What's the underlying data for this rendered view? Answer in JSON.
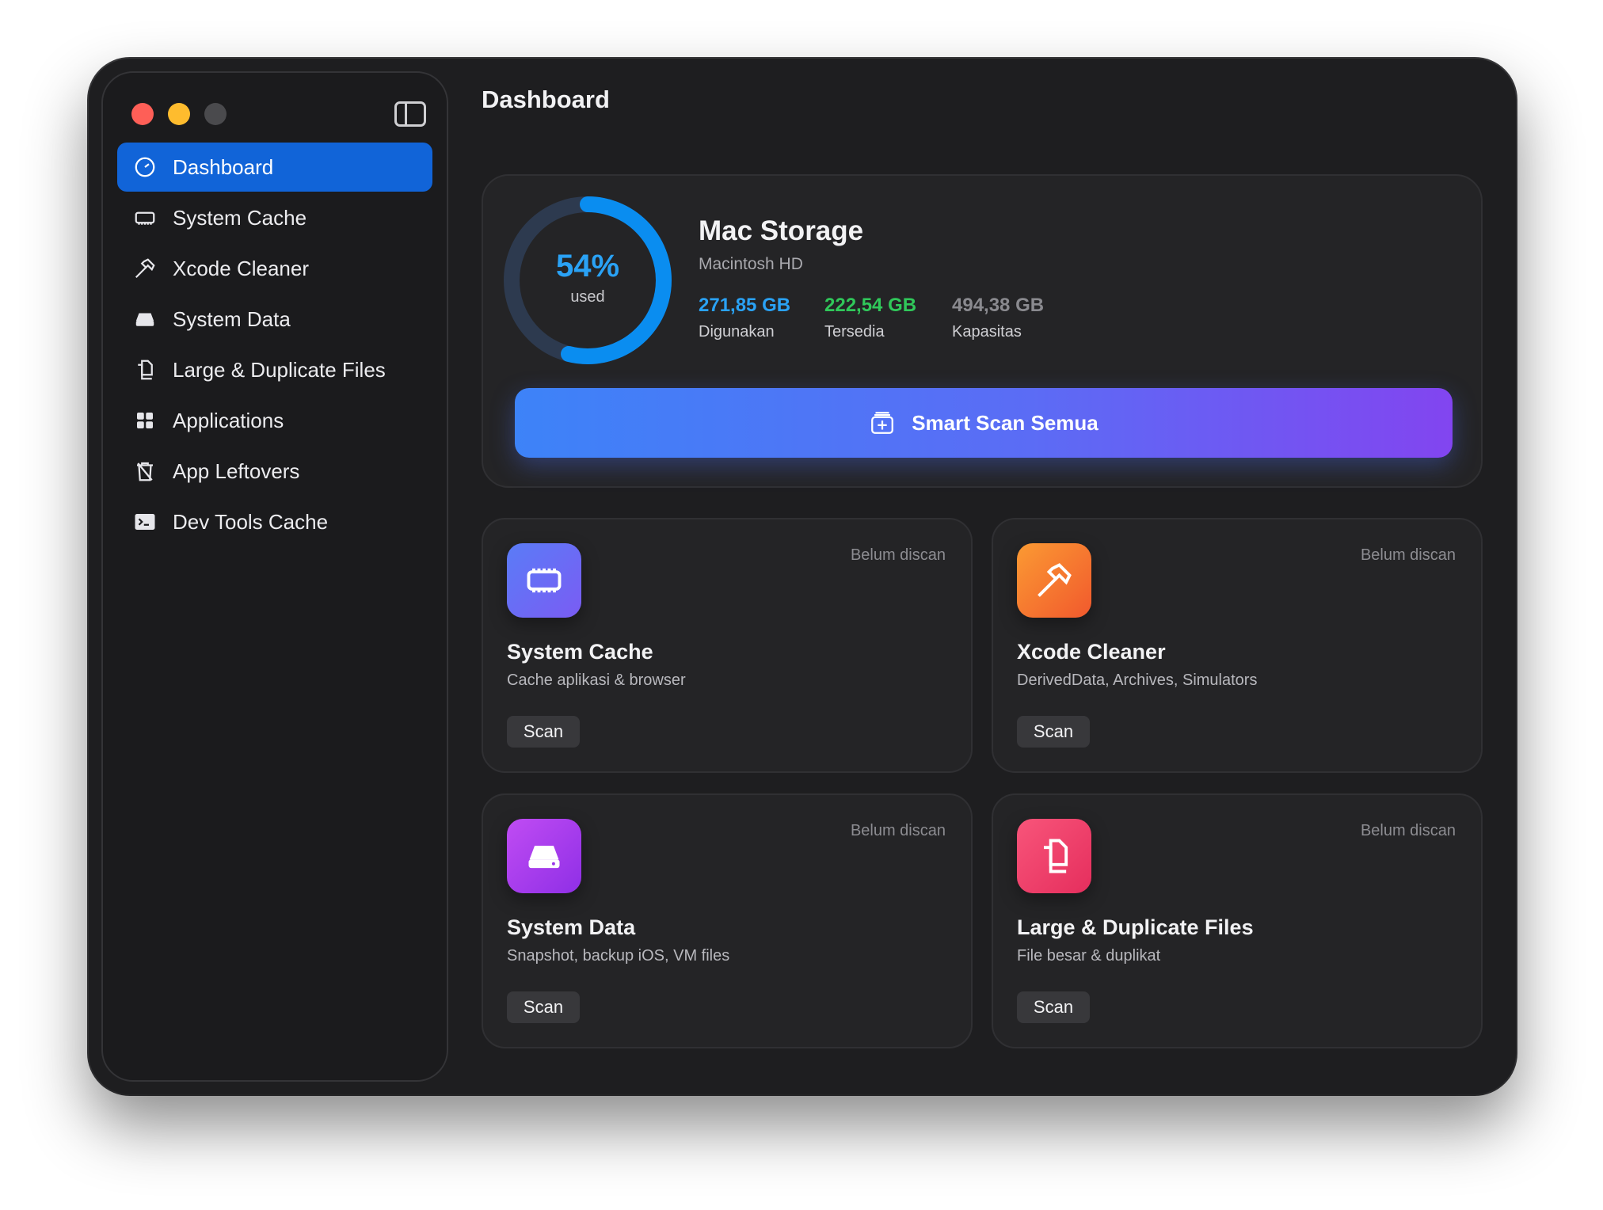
{
  "window": {
    "title": "Dashboard"
  },
  "sidebar": {
    "items": [
      {
        "label": "Dashboard",
        "icon": "gauge-icon",
        "active": true
      },
      {
        "label": "System Cache",
        "icon": "memory-chip-icon"
      },
      {
        "label": "Xcode Cleaner",
        "icon": "hammer-icon"
      },
      {
        "label": "System Data",
        "icon": "drive-icon"
      },
      {
        "label": "Large & Duplicate Files",
        "icon": "documents-icon"
      },
      {
        "label": "Applications",
        "icon": "grid-icon"
      },
      {
        "label": "App Leftovers",
        "icon": "trash-icon"
      },
      {
        "label": "Dev Tools Cache",
        "icon": "terminal-icon"
      }
    ]
  },
  "storage": {
    "percent_label": "54%",
    "percent_value": 0.54,
    "used_label": "used",
    "title": "Mac Storage",
    "volume": "Macintosh HD",
    "used_value": "271,85 GB",
    "used_caption": "Digunakan",
    "available_value": "222,54 GB",
    "available_caption": "Tersedia",
    "capacity_value": "494,38 GB",
    "capacity_caption": "Kapasitas",
    "smart_scan_label": "Smart Scan Semua",
    "colors": {
      "used": "#2aa2f5",
      "available": "#30c85a",
      "capacity": "#8a8a8f"
    }
  },
  "tools": [
    {
      "title": "System Cache",
      "desc": "Cache aplikasi & browser",
      "status": "Belum discan",
      "scan_label": "Scan",
      "icon": "memory-chip-icon",
      "gradient": [
        "#5a7cf7",
        "#7a5cf3"
      ]
    },
    {
      "title": "Xcode Cleaner",
      "desc": "DerivedData, Archives, Simulators",
      "status": "Belum discan",
      "scan_label": "Scan",
      "icon": "hammer-icon",
      "gradient": [
        "#fb9a33",
        "#f1592d"
      ]
    },
    {
      "title": "System Data",
      "desc": "Snapshot, backup iOS, VM files",
      "status": "Belum discan",
      "scan_label": "Scan",
      "icon": "drive-icon",
      "gradient": [
        "#c04cf3",
        "#8f2fe6"
      ]
    },
    {
      "title": "Large & Duplicate Files",
      "desc": "File besar & duplikat",
      "status": "Belum discan",
      "scan_label": "Scan",
      "icon": "documents-icon",
      "gradient": [
        "#f8557a",
        "#e52e5d"
      ]
    }
  ]
}
